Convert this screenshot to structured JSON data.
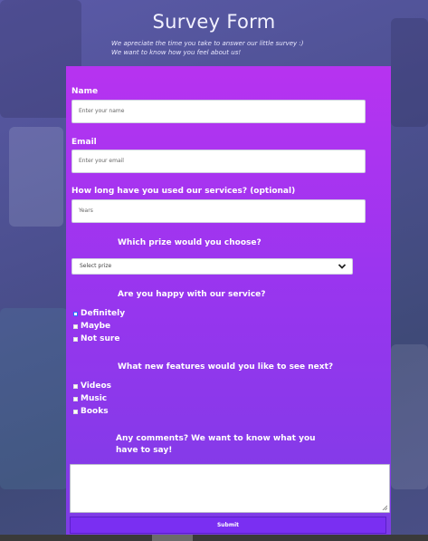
{
  "header": {
    "title": "Survey Form",
    "description_line1": "We apreciate the time you take to answer our little survey :)",
    "description_line2": "We want to know how you feel about us!"
  },
  "form": {
    "name": {
      "label": "Name",
      "placeholder": "Enter your name"
    },
    "email": {
      "label": "Email",
      "placeholder": "Enter your email"
    },
    "years": {
      "label": "How long have you used our services? (optional)",
      "placeholder": "Years"
    },
    "prize": {
      "label": "Which prize would you choose?",
      "selected": "Select prize"
    },
    "happy": {
      "label": "Are you happy with our service?",
      "options": [
        "Definitely",
        "Maybe",
        "Not sure"
      ]
    },
    "features": {
      "label": "What new features would you like to see next?",
      "options": [
        "Videos",
        "Music",
        "Books"
      ]
    },
    "comments": {
      "label": "Any comments? We want to know what you have to say!"
    },
    "submit_label": "Submit"
  },
  "colors": {
    "panel_top": "#b733f0",
    "panel_bottom": "#7d3ce6",
    "submit": "#7a2ff2"
  }
}
